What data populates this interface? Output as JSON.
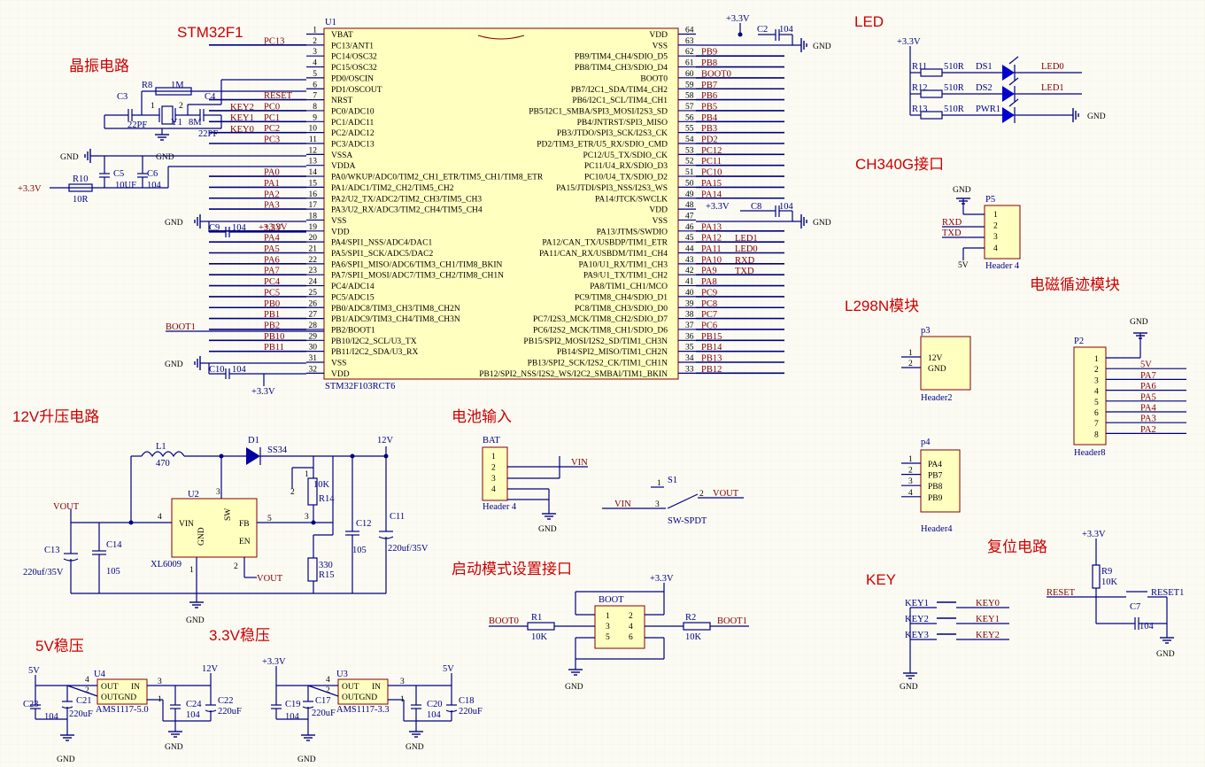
{
  "titles": {
    "stm": "STM32F1",
    "crystal": "晶振电路",
    "led": "LED",
    "ch340": "CH340G接口",
    "em": "电磁循迹模块",
    "l298": "L298N模块",
    "boost12": "12V升压电路",
    "bat": "电池输入",
    "boot": "启动模式设置接口",
    "reset": "复位电路",
    "key": "KEY",
    "reg5": "5V稳压",
    "reg33": "3.3V稳压"
  },
  "mcu": {
    "ref": "U1",
    "part": "STM32F103RCT6",
    "left_pins": [
      {
        "num": "1",
        "name": "VBAT",
        "net": ""
      },
      {
        "num": "2",
        "name": "PC13/ANT1",
        "net": "PC13"
      },
      {
        "num": "3",
        "name": "PC14/OSC32",
        "net": ""
      },
      {
        "num": "4",
        "name": "PC15/OSC32",
        "net": ""
      },
      {
        "num": "5",
        "name": "PD0/OSCIN",
        "net": ""
      },
      {
        "num": "6",
        "name": "PD1/OSCOUT",
        "net": ""
      },
      {
        "num": "7",
        "name": "NRST",
        "net": "RESET"
      },
      {
        "num": "8",
        "name": "PC0/ADC10",
        "net": "PC0"
      },
      {
        "num": "9",
        "name": "PC1/ADC11",
        "net": "PC1"
      },
      {
        "num": "10",
        "name": "PC2/ADC12",
        "net": "PC2"
      },
      {
        "num": "11",
        "name": "PC3/ADC13",
        "net": "PC3"
      },
      {
        "num": "12",
        "name": "VSSA",
        "net": ""
      },
      {
        "num": "13",
        "name": "VDDA",
        "net": ""
      },
      {
        "num": "14",
        "name": "PA0/WKUP/ADC0/TIM2_CH1_ETR/TIM5_CH1/TIM8_ETR",
        "net": "PA0"
      },
      {
        "num": "15",
        "name": "PA1/ADC1/TIM2_CH2/TIM5_CH2",
        "net": "PA1"
      },
      {
        "num": "16",
        "name": "PA2/U2_TX/ADC2/TIM2_CH3/TIM5_CH3",
        "net": "PA2"
      },
      {
        "num": "17",
        "name": "PA3/U2_RX/ADC3/TIM2_CH4/TIM5_CH4",
        "net": "PA3"
      },
      {
        "num": "18",
        "name": "VSS",
        "net": ""
      },
      {
        "num": "19",
        "name": "VDD",
        "net": "+3.3V"
      },
      {
        "num": "20",
        "name": "PA4/SPI1_NSS/ADC4/DAC1",
        "net": "PA4"
      },
      {
        "num": "21",
        "name": "PA5/SPI1_SCK/ADC5/DAC2",
        "net": "PA5"
      },
      {
        "num": "22",
        "name": "PA6/SPI1_MISO/ADC6/TIM3_CH1/TIM8_BKIN",
        "net": "PA6"
      },
      {
        "num": "23",
        "name": "PA7/SPI1_MOSI/ADC7/TIM3_CH2/TIM8_CH1N",
        "net": "PA7"
      },
      {
        "num": "24",
        "name": "PC4/ADC14",
        "net": "PC4"
      },
      {
        "num": "25",
        "name": "PC5/ADC15",
        "net": "PC5"
      },
      {
        "num": "26",
        "name": "PB0/ADC8/TIM3_CH3/TIM8_CH2N",
        "net": "PB0"
      },
      {
        "num": "27",
        "name": "PB1/ADC9/TIM3_CH4/TIM8_CH3N",
        "net": "PB1"
      },
      {
        "num": "28",
        "name": "PB2/BOOT1",
        "net": "PB2"
      },
      {
        "num": "29",
        "name": "PB10/I2C2_SCL/U3_TX",
        "net": "PB10"
      },
      {
        "num": "30",
        "name": "PB11/I2C2_SDA/U3_RX",
        "net": "PB11"
      },
      {
        "num": "31",
        "name": "VSS",
        "net": ""
      },
      {
        "num": "32",
        "name": "VDD",
        "net": ""
      }
    ],
    "right_pins": [
      {
        "num": "64",
        "name": "VDD",
        "net": "+3.3V"
      },
      {
        "num": "63",
        "name": "VSS",
        "net": ""
      },
      {
        "num": "62",
        "name": "PB9/TIM4_CH4/SDIO_D5",
        "net": "PB9"
      },
      {
        "num": "61",
        "name": "PB8/TIM4_CH3/SDIO_D4",
        "net": "PB8"
      },
      {
        "num": "60",
        "name": "BOOT0",
        "net": "BOOT0"
      },
      {
        "num": "59",
        "name": "PB7/I2C1_SDA/TIM4_CH2",
        "net": "PB7"
      },
      {
        "num": "58",
        "name": "PB6/I2C1_SCL/TIM4_CH1",
        "net": "PB6"
      },
      {
        "num": "57",
        "name": "PB5/I2C1_SMBA/SPI3_MOSI/I2S3_SD",
        "net": "PB5"
      },
      {
        "num": "56",
        "name": "PB4/JNTRST/SPI3_MISO",
        "net": "PB4"
      },
      {
        "num": "55",
        "name": "PB3/JTDO/SPI3_SCK/I2S3_CK",
        "net": "PB3"
      },
      {
        "num": "54",
        "name": "PD2/TIM3_ETR/U5_RX/SDIO_CMD",
        "net": "PD2"
      },
      {
        "num": "53",
        "name": "PC12/U5_TX/SDIO_CK",
        "net": "PC12"
      },
      {
        "num": "52",
        "name": "PC11/U4_RX/SDIO_D3",
        "net": "PC11"
      },
      {
        "num": "51",
        "name": "PC10/U4_TX/SDIO_D2",
        "net": "PC10"
      },
      {
        "num": "50",
        "name": "PA15/JTDI/SPI3_NSS/I2S3_WS",
        "net": "PA15"
      },
      {
        "num": "49",
        "name": "PA14/JTCK/SWCLK",
        "net": "PA14"
      },
      {
        "num": "48",
        "name": "VDD",
        "net": "+3.3V"
      },
      {
        "num": "47",
        "name": "VSS",
        "net": ""
      },
      {
        "num": "46",
        "name": "PA13/JTMS/SWDIO",
        "net": "PA13"
      },
      {
        "num": "45",
        "name": "PA12/CAN_TX/USBDP/TIM1_ETR",
        "net": "PA12"
      },
      {
        "num": "44",
        "name": "PA11/CAN_RX/USBDM/TIM1_CH4",
        "net": "PA11"
      },
      {
        "num": "43",
        "name": "PA10/U1_RX/TIM1_CH3",
        "net": "PA10"
      },
      {
        "num": "42",
        "name": "PA9/U1_TX/TIM1_CH2",
        "net": "PA9"
      },
      {
        "num": "41",
        "name": "PA8/TIM1_CH1/MCO",
        "net": "PA8"
      },
      {
        "num": "40",
        "name": "PC9/TIM8_CH4/SDIO_D1",
        "net": "PC9"
      },
      {
        "num": "39",
        "name": "PC8/TIM8_CH3/SDIO_D0",
        "net": "PC8"
      },
      {
        "num": "38",
        "name": "PC7/I2S3_MCK/TIM8_CH2/SDIO_D7",
        "net": "PC7"
      },
      {
        "num": "37",
        "name": "PC6/I2S2_MCK/TIM8_CH1/SDIO_D6",
        "net": "PC6"
      },
      {
        "num": "36",
        "name": "PB15/SPI2_MOSI/I2S2_SD/TIM1_CH3N",
        "net": "PB15"
      },
      {
        "num": "35",
        "name": "PB14/SPI2_MISO/TIM1_CH2N",
        "net": "PB14"
      },
      {
        "num": "34",
        "name": "PB13/SPI2_SCK/I2S2_CK/TIM1_CH1N",
        "net": "PB13"
      },
      {
        "num": "33",
        "name": "PB12/SPI2_NSS/I2S2_WS/I2C2_SMBAl/TIM1_BKIN",
        "net": "PB12"
      }
    ],
    "right_extra": {
      "led1": "LED1",
      "led0": "LED0",
      "rxd": "RXD",
      "txd": "TXD"
    },
    "left_extra": {
      "key2": "KEY2",
      "key1": "KEY1",
      "key0": "KEY0",
      "boot1": "BOOT1"
    }
  },
  "labels": {
    "gnd": "GND",
    "v33": "+3.3V",
    "v5": "5V",
    "v12": "12V",
    "vout": "VOUT",
    "vin": "VIN",
    "reset": "RESET",
    "boot0": "BOOT0",
    "boot1": "BOOT1"
  },
  "crystal": {
    "c3": "C3",
    "c3v": "22PF",
    "c4": "C4",
    "c4v": "22PF",
    "r8": "R8",
    "r8v": "1M",
    "y1": "Y1",
    "y1v": "8M",
    "pin1": "1",
    "pin2": "2"
  },
  "vdda": {
    "c5": "C5",
    "c5v": "10UF",
    "c6": "C6",
    "c6v": "104",
    "r10": "R10",
    "r10v": "10R"
  },
  "decoup": {
    "c9": "C9",
    "c9v": "104",
    "c10": "C10",
    "c10v": "104",
    "c2": "C2",
    "c2v": "104",
    "c8": "C8",
    "c8v": "104"
  },
  "led": {
    "rows": [
      {
        "r": "R11",
        "rv": "510R",
        "d": "DS1",
        "net": "LED0"
      },
      {
        "r": "R12",
        "rv": "510R",
        "d": "DS2",
        "net": "LED1"
      },
      {
        "r": "R13",
        "rv": "510R",
        "d": "PWR1",
        "net": ""
      }
    ]
  },
  "ch340": {
    "ref": "P5",
    "part": "Header 4",
    "pins": [
      "1",
      "2",
      "3",
      "4"
    ],
    "rxd": "RXD",
    "txd": "TXD"
  },
  "l298": {
    "p3": {
      "ref": "p3",
      "part": "Header2",
      "pins": [
        "1",
        "2"
      ],
      "names": [
        "12V",
        "GND"
      ]
    },
    "p4": {
      "ref": "p4",
      "part": "Header4",
      "pins": [
        "1",
        "2",
        "3",
        "4"
      ],
      "names": [
        "PA4",
        "PB7",
        "PB8",
        "PB9"
      ]
    }
  },
  "em": {
    "ref": "P2",
    "part": "Header8",
    "pins": [
      "1",
      "2",
      "3",
      "4",
      "5",
      "6",
      "7",
      "8"
    ],
    "nets": [
      "",
      "5V",
      "PA7",
      "PA6",
      "PA5",
      "PA4",
      "PA3",
      "PA2"
    ]
  },
  "boost": {
    "l1": "L1",
    "l1v": "470",
    "d1": "D1",
    "d1v": "SS34",
    "u2": "U2",
    "u2v": "XL6009",
    "vin": "VIN",
    "gnd": "GND",
    "sw": "SW",
    "fb": "FB",
    "en": "EN",
    "r14": "R14",
    "r14v": "10K",
    "r15": "R15",
    "r15v": "330",
    "c11": "C11",
    "c11v": "220uf/35V",
    "c12": "C12",
    "c12v": "105",
    "c13": "C13",
    "c13v": "220uf/35V",
    "c14": "C14",
    "c14v": "105",
    "p4": "4",
    "p3": "3",
    "p5": "5",
    "p2": "2",
    "p1": "1",
    "p2b": "2",
    "p3b": "3"
  },
  "bat": {
    "ref": "BAT",
    "part": "Header 4",
    "pins": [
      "1",
      "2",
      "3",
      "4"
    ],
    "s1": "S1",
    "s1v": "SW-SPDT",
    "p1": "1",
    "p2": "2",
    "p3": "3"
  },
  "bootcfg": {
    "ref": "BOOT",
    "r1": "R1",
    "r1v": "10K",
    "r2": "R2",
    "r2v": "10K",
    "pins": [
      "1",
      "2",
      "3",
      "4",
      "5",
      "6"
    ]
  },
  "reset": {
    "r9": "R9",
    "r9v": "10K",
    "s": "RESET1",
    "c7": "C7",
    "c7v": "104"
  },
  "keys": {
    "rows": [
      {
        "s": "KEY1",
        "net": "KEY0"
      },
      {
        "s": "KEY2",
        "net": "KEY1"
      },
      {
        "s": "KEY3",
        "net": "KEY2"
      }
    ]
  },
  "reg5": {
    "u": "U4",
    "part": "AMS1117-5.0",
    "out": "OUT",
    "in": "IN",
    "outgnd": "OUTGND",
    "c23": "C23",
    "c23v": "104",
    "c21": "C21",
    "c21v": "220uF",
    "c24": "C24",
    "c24v": "104",
    "c22": "C22",
    "c22v": "220uF",
    "p1": "1",
    "p2": "2",
    "p3": "3",
    "p4": "4"
  },
  "reg33": {
    "u": "U3",
    "part": "AMS1117-3.3",
    "out": "OUT",
    "in": "IN",
    "outgnd": "OUTGND",
    "c19": "C19",
    "c19v": "104",
    "c17": "C17",
    "c17v": "220uF",
    "c20": "C20",
    "c20v": "104",
    "c18": "C18",
    "c18v": "220uF",
    "p1": "1",
    "p2": "2",
    "p3": "3",
    "p4": "4"
  }
}
